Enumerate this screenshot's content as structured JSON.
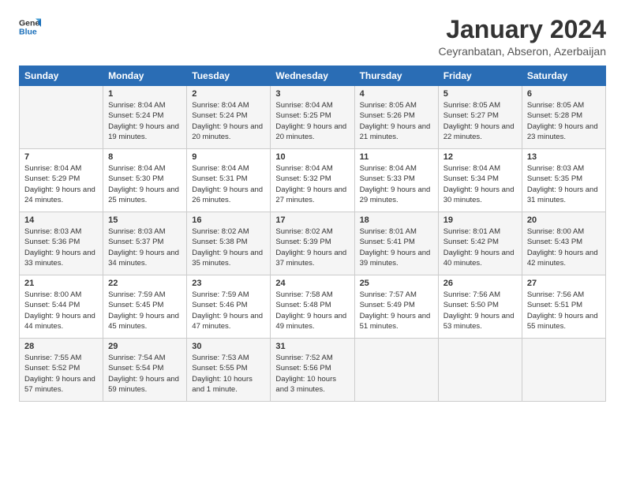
{
  "logo": {
    "text_general": "General",
    "text_blue": "Blue"
  },
  "header": {
    "title": "January 2024",
    "subtitle": "Ceyranbatan, Abseron, Azerbaijan"
  },
  "weekdays": [
    "Sunday",
    "Monday",
    "Tuesday",
    "Wednesday",
    "Thursday",
    "Friday",
    "Saturday"
  ],
  "weeks": [
    [
      {
        "day": "",
        "sunrise": "",
        "sunset": "",
        "daylight": ""
      },
      {
        "day": "1",
        "sunrise": "Sunrise: 8:04 AM",
        "sunset": "Sunset: 5:24 PM",
        "daylight": "Daylight: 9 hours and 19 minutes."
      },
      {
        "day": "2",
        "sunrise": "Sunrise: 8:04 AM",
        "sunset": "Sunset: 5:24 PM",
        "daylight": "Daylight: 9 hours and 20 minutes."
      },
      {
        "day": "3",
        "sunrise": "Sunrise: 8:04 AM",
        "sunset": "Sunset: 5:25 PM",
        "daylight": "Daylight: 9 hours and 20 minutes."
      },
      {
        "day": "4",
        "sunrise": "Sunrise: 8:05 AM",
        "sunset": "Sunset: 5:26 PM",
        "daylight": "Daylight: 9 hours and 21 minutes."
      },
      {
        "day": "5",
        "sunrise": "Sunrise: 8:05 AM",
        "sunset": "Sunset: 5:27 PM",
        "daylight": "Daylight: 9 hours and 22 minutes."
      },
      {
        "day": "6",
        "sunrise": "Sunrise: 8:05 AM",
        "sunset": "Sunset: 5:28 PM",
        "daylight": "Daylight: 9 hours and 23 minutes."
      }
    ],
    [
      {
        "day": "7",
        "sunrise": "Sunrise: 8:04 AM",
        "sunset": "Sunset: 5:29 PM",
        "daylight": "Daylight: 9 hours and 24 minutes."
      },
      {
        "day": "8",
        "sunrise": "Sunrise: 8:04 AM",
        "sunset": "Sunset: 5:30 PM",
        "daylight": "Daylight: 9 hours and 25 minutes."
      },
      {
        "day": "9",
        "sunrise": "Sunrise: 8:04 AM",
        "sunset": "Sunset: 5:31 PM",
        "daylight": "Daylight: 9 hours and 26 minutes."
      },
      {
        "day": "10",
        "sunrise": "Sunrise: 8:04 AM",
        "sunset": "Sunset: 5:32 PM",
        "daylight": "Daylight: 9 hours and 27 minutes."
      },
      {
        "day": "11",
        "sunrise": "Sunrise: 8:04 AM",
        "sunset": "Sunset: 5:33 PM",
        "daylight": "Daylight: 9 hours and 29 minutes."
      },
      {
        "day": "12",
        "sunrise": "Sunrise: 8:04 AM",
        "sunset": "Sunset: 5:34 PM",
        "daylight": "Daylight: 9 hours and 30 minutes."
      },
      {
        "day": "13",
        "sunrise": "Sunrise: 8:03 AM",
        "sunset": "Sunset: 5:35 PM",
        "daylight": "Daylight: 9 hours and 31 minutes."
      }
    ],
    [
      {
        "day": "14",
        "sunrise": "Sunrise: 8:03 AM",
        "sunset": "Sunset: 5:36 PM",
        "daylight": "Daylight: 9 hours and 33 minutes."
      },
      {
        "day": "15",
        "sunrise": "Sunrise: 8:03 AM",
        "sunset": "Sunset: 5:37 PM",
        "daylight": "Daylight: 9 hours and 34 minutes."
      },
      {
        "day": "16",
        "sunrise": "Sunrise: 8:02 AM",
        "sunset": "Sunset: 5:38 PM",
        "daylight": "Daylight: 9 hours and 35 minutes."
      },
      {
        "day": "17",
        "sunrise": "Sunrise: 8:02 AM",
        "sunset": "Sunset: 5:39 PM",
        "daylight": "Daylight: 9 hours and 37 minutes."
      },
      {
        "day": "18",
        "sunrise": "Sunrise: 8:01 AM",
        "sunset": "Sunset: 5:41 PM",
        "daylight": "Daylight: 9 hours and 39 minutes."
      },
      {
        "day": "19",
        "sunrise": "Sunrise: 8:01 AM",
        "sunset": "Sunset: 5:42 PM",
        "daylight": "Daylight: 9 hours and 40 minutes."
      },
      {
        "day": "20",
        "sunrise": "Sunrise: 8:00 AM",
        "sunset": "Sunset: 5:43 PM",
        "daylight": "Daylight: 9 hours and 42 minutes."
      }
    ],
    [
      {
        "day": "21",
        "sunrise": "Sunrise: 8:00 AM",
        "sunset": "Sunset: 5:44 PM",
        "daylight": "Daylight: 9 hours and 44 minutes."
      },
      {
        "day": "22",
        "sunrise": "Sunrise: 7:59 AM",
        "sunset": "Sunset: 5:45 PM",
        "daylight": "Daylight: 9 hours and 45 minutes."
      },
      {
        "day": "23",
        "sunrise": "Sunrise: 7:59 AM",
        "sunset": "Sunset: 5:46 PM",
        "daylight": "Daylight: 9 hours and 47 minutes."
      },
      {
        "day": "24",
        "sunrise": "Sunrise: 7:58 AM",
        "sunset": "Sunset: 5:48 PM",
        "daylight": "Daylight: 9 hours and 49 minutes."
      },
      {
        "day": "25",
        "sunrise": "Sunrise: 7:57 AM",
        "sunset": "Sunset: 5:49 PM",
        "daylight": "Daylight: 9 hours and 51 minutes."
      },
      {
        "day": "26",
        "sunrise": "Sunrise: 7:56 AM",
        "sunset": "Sunset: 5:50 PM",
        "daylight": "Daylight: 9 hours and 53 minutes."
      },
      {
        "day": "27",
        "sunrise": "Sunrise: 7:56 AM",
        "sunset": "Sunset: 5:51 PM",
        "daylight": "Daylight: 9 hours and 55 minutes."
      }
    ],
    [
      {
        "day": "28",
        "sunrise": "Sunrise: 7:55 AM",
        "sunset": "Sunset: 5:52 PM",
        "daylight": "Daylight: 9 hours and 57 minutes."
      },
      {
        "day": "29",
        "sunrise": "Sunrise: 7:54 AM",
        "sunset": "Sunset: 5:54 PM",
        "daylight": "Daylight: 9 hours and 59 minutes."
      },
      {
        "day": "30",
        "sunrise": "Sunrise: 7:53 AM",
        "sunset": "Sunset: 5:55 PM",
        "daylight": "Daylight: 10 hours and 1 minute."
      },
      {
        "day": "31",
        "sunrise": "Sunrise: 7:52 AM",
        "sunset": "Sunset: 5:56 PM",
        "daylight": "Daylight: 10 hours and 3 minutes."
      },
      {
        "day": "",
        "sunrise": "",
        "sunset": "",
        "daylight": ""
      },
      {
        "day": "",
        "sunrise": "",
        "sunset": "",
        "daylight": ""
      },
      {
        "day": "",
        "sunrise": "",
        "sunset": "",
        "daylight": ""
      }
    ]
  ]
}
